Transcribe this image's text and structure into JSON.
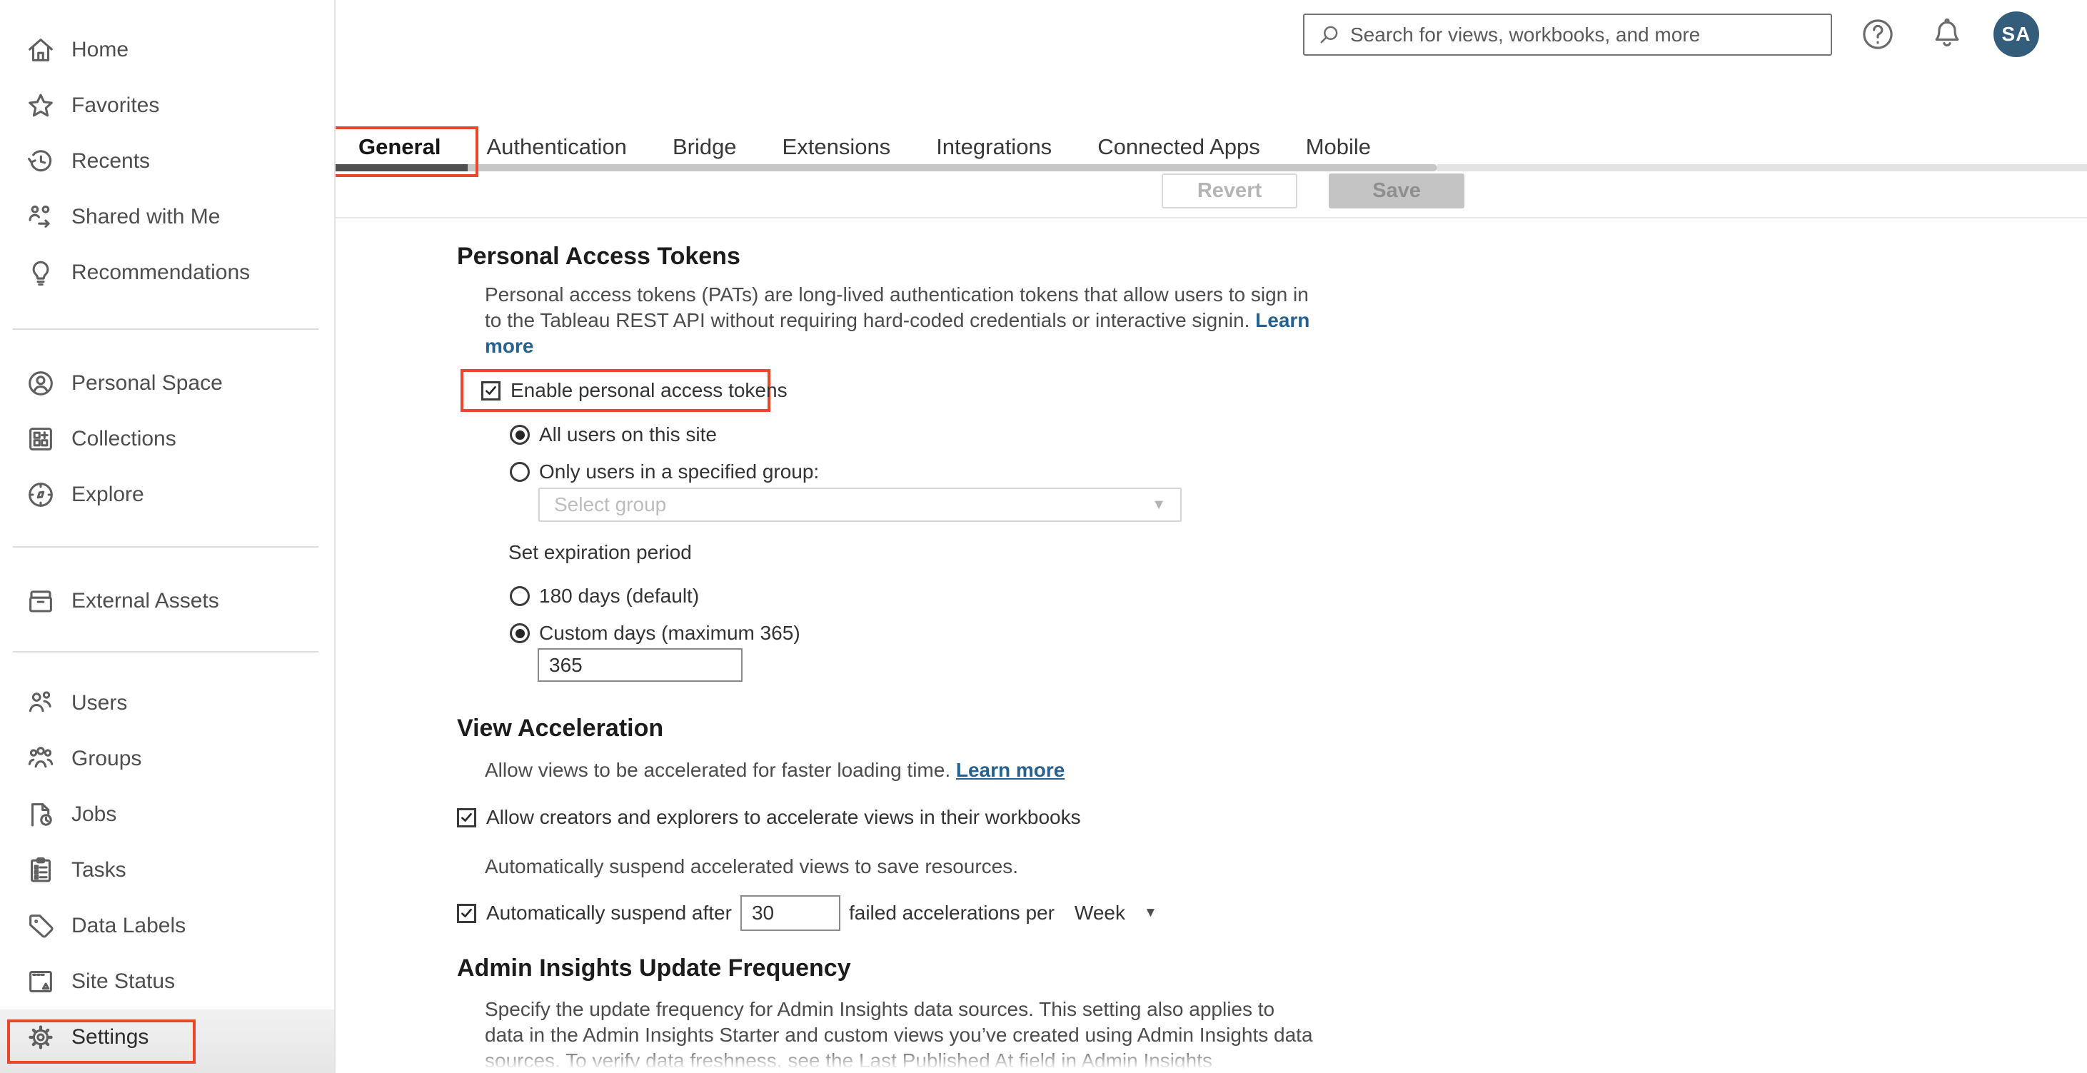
{
  "header": {
    "search_placeholder": "Search for views, workbooks, and more",
    "avatar_initials": "SA"
  },
  "sidebar": {
    "items": [
      "Home",
      "Favorites",
      "Recents",
      "Shared with Me",
      "Recommendations",
      "Personal Space",
      "Collections",
      "Explore",
      "External Assets",
      "Users",
      "Groups",
      "Jobs",
      "Tasks",
      "Data Labels",
      "Site Status",
      "Settings"
    ],
    "active_item": "Settings"
  },
  "tabs": {
    "items": [
      "General",
      "Authentication",
      "Bridge",
      "Extensions",
      "Integrations",
      "Connected Apps",
      "Mobile"
    ],
    "active": "General"
  },
  "toolbar": {
    "revert_label": "Revert",
    "save_label": "Save"
  },
  "sections": {
    "pat": {
      "title": "Personal Access Tokens",
      "description": "Personal access tokens (PATs) are long-lived authentication tokens that allow users to sign in to the Tableau REST API without requiring hard-coded credentials or interactive signin.",
      "learn_more": "Learn more",
      "enable_label": "Enable personal access tokens",
      "enable_checked": true,
      "radio_all_users": "All users on this site",
      "radio_specified_group": "Only users in a specified group:",
      "select_group_placeholder": "Select group",
      "expiration_label": "Set expiration period",
      "radio_180_days": "180 days (default)",
      "radio_custom_days": "Custom days (maximum 365)",
      "custom_days_value": "365"
    },
    "view_acceleration": {
      "title": "View Acceleration",
      "description": "Allow views to be accelerated for faster loading time.",
      "learn_more": "Learn more",
      "allow_label": "Allow creators and explorers to accelerate views in their workbooks",
      "allow_checked": true,
      "suspend_intro": "Automatically suspend accelerated views to save resources.",
      "suspend_before_label": "Automatically suspend after",
      "suspend_value": "30",
      "suspend_after_label": "failed accelerations per",
      "suspend_checked": true,
      "period_value": "Week"
    },
    "admin_insights": {
      "title": "Admin Insights Update Frequency",
      "description": "Specify the update frequency for Admin Insights data sources. This setting also applies to data in the Admin Insights Starter and custom views you’ve created using Admin Insights data sources. To verify data freshness, see the Last Published At field in Admin Insights"
    }
  },
  "icons": {
    "caret_down": "▼"
  },
  "colors": {
    "annotation_red": "#e8472c",
    "link_blue": "#27618f",
    "avatar_bg": "#345c7b",
    "active_tab_underline": "#4f4f4f"
  }
}
